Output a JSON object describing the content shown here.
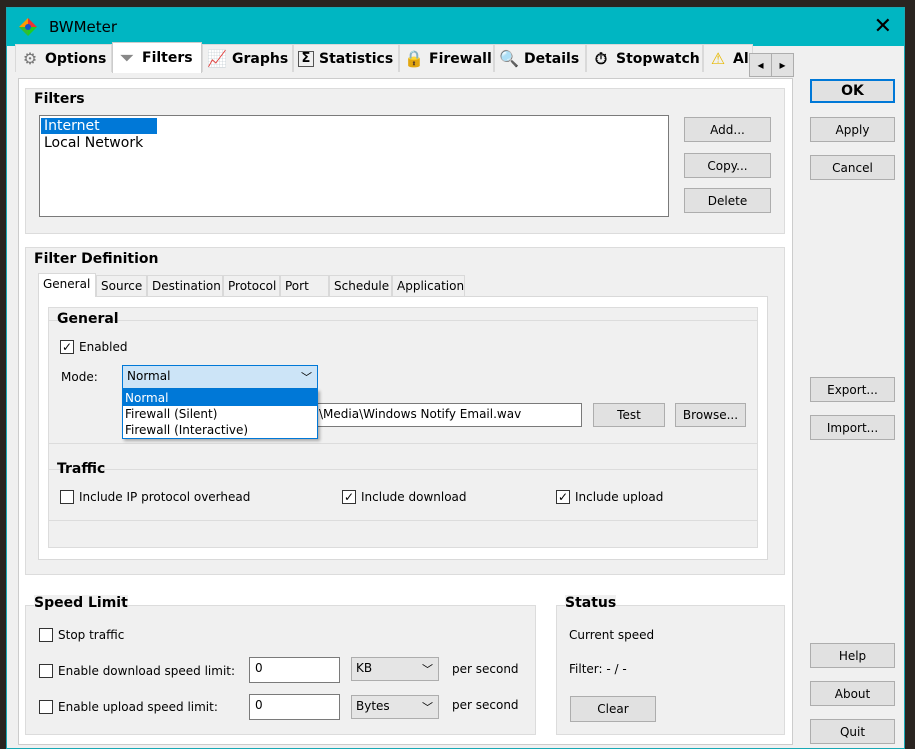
{
  "window": {
    "title": "BWMeter",
    "close": "✕"
  },
  "tabs": [
    {
      "label": "Options",
      "icon": "⚙"
    },
    {
      "label": "Filters",
      "icon": "⏷"
    },
    {
      "label": "Graphs",
      "icon": "📈"
    },
    {
      "label": "Statistics",
      "icon": "Σ"
    },
    {
      "label": "Firewall",
      "icon": "🔒"
    },
    {
      "label": "Details",
      "icon": "🔍"
    },
    {
      "label": "Stopwatch",
      "icon": "⏱"
    },
    {
      "label": "Al",
      "icon": "⚠"
    }
  ],
  "tab_scroll": {
    "left": "◂",
    "right": "▸"
  },
  "filters": {
    "title": "Filters",
    "items": [
      "Internet",
      "Local Network"
    ],
    "add": "Add...",
    "copy": "Copy...",
    "delete": "Delete"
  },
  "definition": {
    "title": "Filter Definition",
    "subtabs": [
      "General",
      "Source",
      "Destination",
      "Protocol",
      "Port",
      "Schedule",
      "Application"
    ],
    "general_title": "General",
    "enabled": "Enabled",
    "mode_label": "Mode:",
    "mode_value": "Normal",
    "mode_options": [
      "Normal",
      "Firewall (Silent)",
      "Firewall (Interactive)"
    ],
    "sound_path": "\\Media\\Windows Notify Email.wav",
    "test": "Test",
    "browse": "Browse...",
    "traffic_title": "Traffic",
    "ip_overhead": "Include IP protocol overhead",
    "download": "Include download",
    "upload": "Include upload"
  },
  "speed": {
    "title": "Speed Limit",
    "stop": "Stop traffic",
    "dl_label": "Enable download speed limit:",
    "dl_value": "0",
    "dl_unit": "KB",
    "ul_label": "Enable upload speed limit:",
    "ul_value": "0",
    "ul_unit": "Bytes",
    "per_second": "per second"
  },
  "status": {
    "title": "Status",
    "current": "Current speed",
    "filter": "Filter: - / -",
    "clear": "Clear"
  },
  "side": {
    "ok": "OK",
    "apply": "Apply",
    "cancel": "Cancel",
    "export": "Export...",
    "import": "Import...",
    "help": "Help",
    "about": "About",
    "quit": "Quit"
  }
}
